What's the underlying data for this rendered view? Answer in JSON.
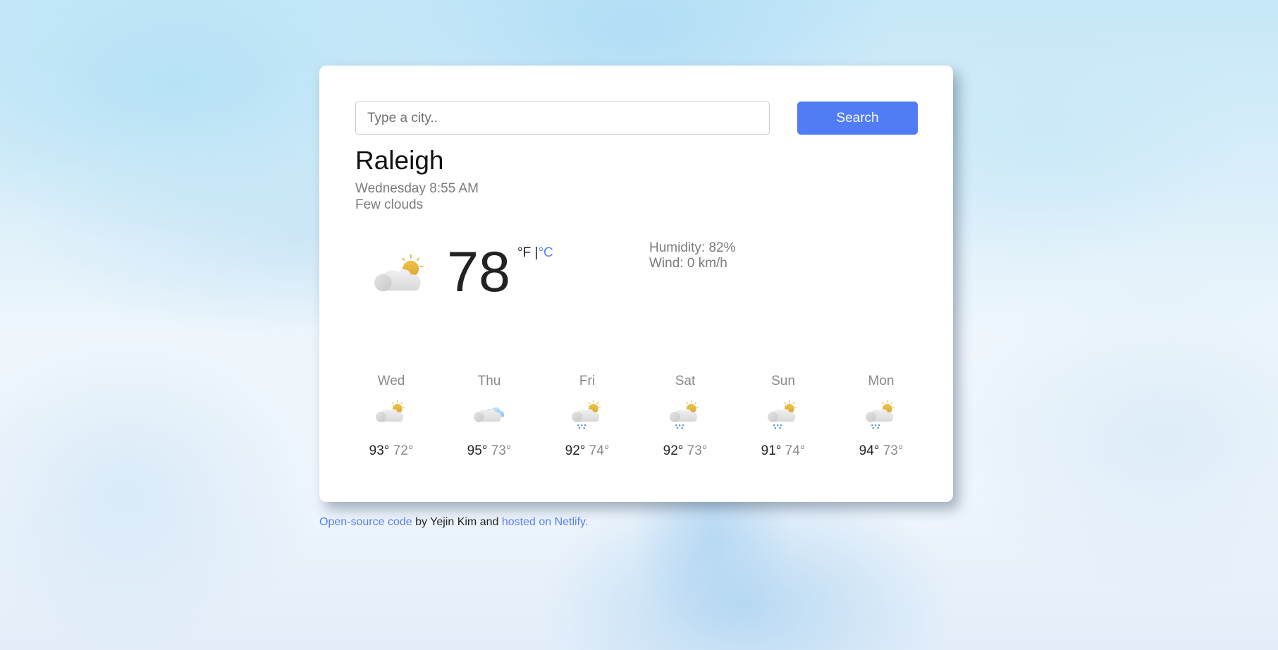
{
  "search": {
    "placeholder": "Type a city..",
    "value": "",
    "button_label": "Search"
  },
  "current": {
    "city": "Raleigh",
    "datetime": "Wednesday 8:55 AM",
    "description": "Few clouds",
    "icon": "few-clouds-day",
    "temperature": "78",
    "unit_fahrenheit": "°F",
    "unit_separator": " |",
    "unit_celsius": "°C",
    "active_unit": "F",
    "humidity": "Humidity: 82%",
    "wind": "Wind: 0 km/h"
  },
  "forecast": [
    {
      "day": "Wed",
      "icon": "few-clouds-day",
      "high": "93°",
      "low": "72°"
    },
    {
      "day": "Thu",
      "icon": "broken-clouds",
      "high": "95°",
      "low": "73°"
    },
    {
      "day": "Fri",
      "icon": "rain-day",
      "high": "92°",
      "low": "74°"
    },
    {
      "day": "Sat",
      "icon": "rain-day",
      "high": "92°",
      "low": "73°"
    },
    {
      "day": "Sun",
      "icon": "rain-day",
      "high": "91°",
      "low": "74°"
    },
    {
      "day": "Mon",
      "icon": "rain-day",
      "high": "94°",
      "low": "73°"
    }
  ],
  "footer": {
    "code_link": "Open-source code",
    "by_text": " by Yejin Kim and ",
    "host_link": "hosted on Netlify."
  },
  "colors": {
    "accent": "#517cf5",
    "link": "#5b7ff0",
    "sun": "#e6b33a",
    "rain": "#4a86d6",
    "cloud_blue": "#9fd0f5"
  }
}
